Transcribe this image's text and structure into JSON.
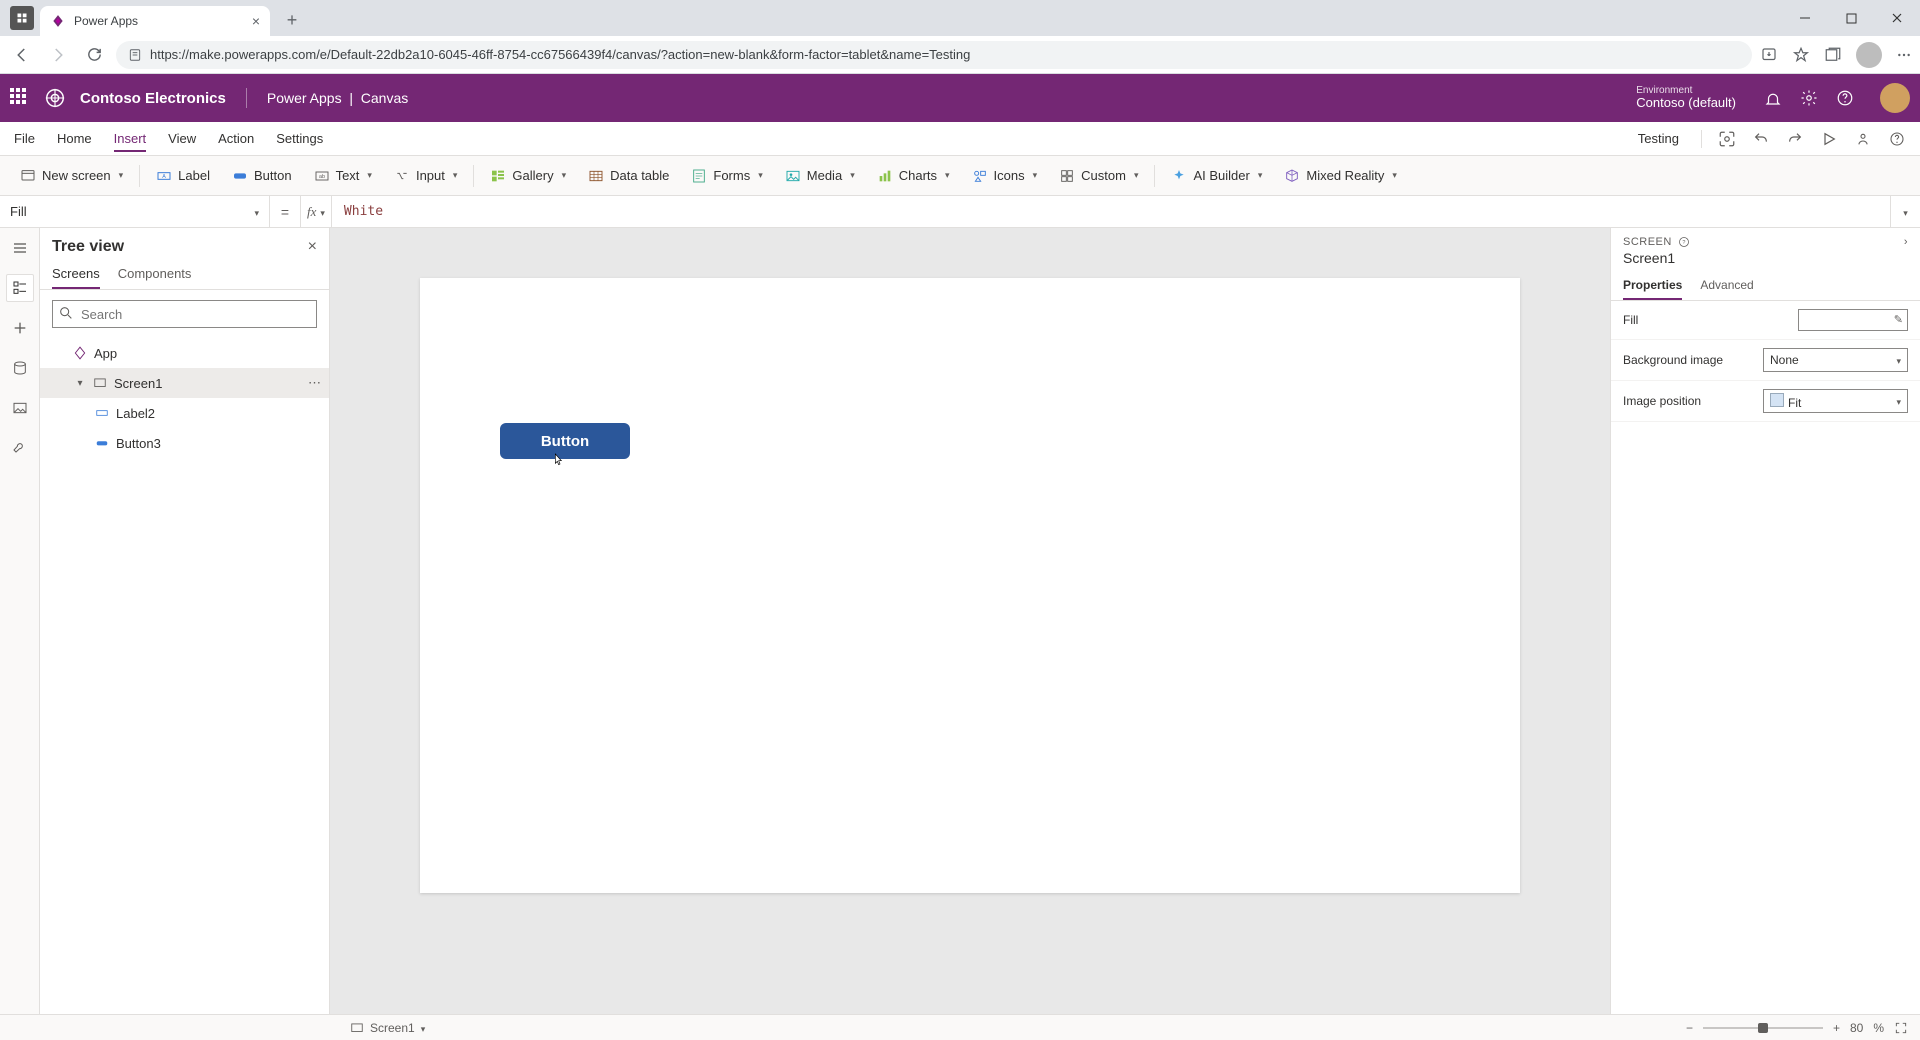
{
  "browser": {
    "tab_title": "Power Apps",
    "url": "https://make.powerapps.com/e/Default-22db2a10-6045-46ff-8754-cc67566439f4/canvas/?action=new-blank&form-factor=tablet&name=Testing"
  },
  "header": {
    "brand": "Contoso Electronics",
    "product": "Power Apps",
    "mode": "Canvas",
    "env_label": "Environment",
    "env_name": "Contoso (default)"
  },
  "menu": {
    "items": [
      "File",
      "Home",
      "Insert",
      "View",
      "Action",
      "Settings"
    ],
    "active_index": 2,
    "app_name": "Testing"
  },
  "ribbon": {
    "new_screen": "New screen",
    "label": "Label",
    "button": "Button",
    "text": "Text",
    "input": "Input",
    "gallery": "Gallery",
    "data_table": "Data table",
    "forms": "Forms",
    "media": "Media",
    "charts": "Charts",
    "icons": "Icons",
    "custom": "Custom",
    "ai_builder": "AI Builder",
    "mixed_reality": "Mixed Reality"
  },
  "formula": {
    "property": "Fill",
    "fx": "fx",
    "value": "White"
  },
  "tree": {
    "title": "Tree view",
    "tabs": [
      "Screens",
      "Components"
    ],
    "active_tab": 0,
    "search_placeholder": "Search",
    "items": {
      "app": "App",
      "screen1": "Screen1",
      "label2": "Label2",
      "button3": "Button3"
    }
  },
  "canvas": {
    "button_text": "Button"
  },
  "props": {
    "type": "SCREEN",
    "name": "Screen1",
    "tabs": [
      "Properties",
      "Advanced"
    ],
    "active_tab": 0,
    "fill_label": "Fill",
    "bg_label": "Background image",
    "bg_value": "None",
    "imgpos_label": "Image position",
    "imgpos_value": "Fit"
  },
  "status": {
    "screen": "Screen1",
    "zoom": "80",
    "pct": "%"
  }
}
